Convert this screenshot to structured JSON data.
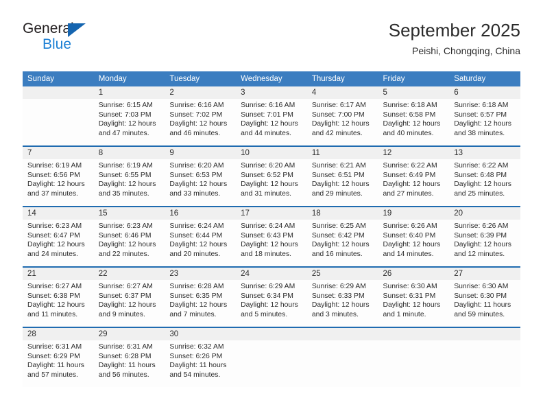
{
  "brand": {
    "name_part1": "General",
    "name_part2": "Blue",
    "triangle_icon": "brand-triangle-icon",
    "accent_blue": "#1b7fd4",
    "triangle_blue": "#1565b0"
  },
  "header": {
    "title": "September 2025",
    "subtitle": "Peishi, Chongqing, China"
  },
  "theme": {
    "header_bg": "#3b7dc0",
    "row_separator": "#1f6bb0",
    "daynum_bg": "#f0f0f0",
    "cell_bg": "#fdfdfd",
    "text": "#2b2b2b"
  },
  "calendar": {
    "columns": [
      "Sunday",
      "Monday",
      "Tuesday",
      "Wednesday",
      "Thursday",
      "Friday",
      "Saturday"
    ],
    "weeks": [
      [
        {
          "day": "",
          "lines": [
            "",
            "",
            "",
            ""
          ]
        },
        {
          "day": "1",
          "lines": [
            "Sunrise: 6:15 AM",
            "Sunset: 7:03 PM",
            "Daylight: 12 hours",
            "and 47 minutes."
          ]
        },
        {
          "day": "2",
          "lines": [
            "Sunrise: 6:16 AM",
            "Sunset: 7:02 PM",
            "Daylight: 12 hours",
            "and 46 minutes."
          ]
        },
        {
          "day": "3",
          "lines": [
            "Sunrise: 6:16 AM",
            "Sunset: 7:01 PM",
            "Daylight: 12 hours",
            "and 44 minutes."
          ]
        },
        {
          "day": "4",
          "lines": [
            "Sunrise: 6:17 AM",
            "Sunset: 7:00 PM",
            "Daylight: 12 hours",
            "and 42 minutes."
          ]
        },
        {
          "day": "5",
          "lines": [
            "Sunrise: 6:18 AM",
            "Sunset: 6:58 PM",
            "Daylight: 12 hours",
            "and 40 minutes."
          ]
        },
        {
          "day": "6",
          "lines": [
            "Sunrise: 6:18 AM",
            "Sunset: 6:57 PM",
            "Daylight: 12 hours",
            "and 38 minutes."
          ]
        }
      ],
      [
        {
          "day": "7",
          "lines": [
            "Sunrise: 6:19 AM",
            "Sunset: 6:56 PM",
            "Daylight: 12 hours",
            "and 37 minutes."
          ]
        },
        {
          "day": "8",
          "lines": [
            "Sunrise: 6:19 AM",
            "Sunset: 6:55 PM",
            "Daylight: 12 hours",
            "and 35 minutes."
          ]
        },
        {
          "day": "9",
          "lines": [
            "Sunrise: 6:20 AM",
            "Sunset: 6:53 PM",
            "Daylight: 12 hours",
            "and 33 minutes."
          ]
        },
        {
          "day": "10",
          "lines": [
            "Sunrise: 6:20 AM",
            "Sunset: 6:52 PM",
            "Daylight: 12 hours",
            "and 31 minutes."
          ]
        },
        {
          "day": "11",
          "lines": [
            "Sunrise: 6:21 AM",
            "Sunset: 6:51 PM",
            "Daylight: 12 hours",
            "and 29 minutes."
          ]
        },
        {
          "day": "12",
          "lines": [
            "Sunrise: 6:22 AM",
            "Sunset: 6:49 PM",
            "Daylight: 12 hours",
            "and 27 minutes."
          ]
        },
        {
          "day": "13",
          "lines": [
            "Sunrise: 6:22 AM",
            "Sunset: 6:48 PM",
            "Daylight: 12 hours",
            "and 25 minutes."
          ]
        }
      ],
      [
        {
          "day": "14",
          "lines": [
            "Sunrise: 6:23 AM",
            "Sunset: 6:47 PM",
            "Daylight: 12 hours",
            "and 24 minutes."
          ]
        },
        {
          "day": "15",
          "lines": [
            "Sunrise: 6:23 AM",
            "Sunset: 6:46 PM",
            "Daylight: 12 hours",
            "and 22 minutes."
          ]
        },
        {
          "day": "16",
          "lines": [
            "Sunrise: 6:24 AM",
            "Sunset: 6:44 PM",
            "Daylight: 12 hours",
            "and 20 minutes."
          ]
        },
        {
          "day": "17",
          "lines": [
            "Sunrise: 6:24 AM",
            "Sunset: 6:43 PM",
            "Daylight: 12 hours",
            "and 18 minutes."
          ]
        },
        {
          "day": "18",
          "lines": [
            "Sunrise: 6:25 AM",
            "Sunset: 6:42 PM",
            "Daylight: 12 hours",
            "and 16 minutes."
          ]
        },
        {
          "day": "19",
          "lines": [
            "Sunrise: 6:26 AM",
            "Sunset: 6:40 PM",
            "Daylight: 12 hours",
            "and 14 minutes."
          ]
        },
        {
          "day": "20",
          "lines": [
            "Sunrise: 6:26 AM",
            "Sunset: 6:39 PM",
            "Daylight: 12 hours",
            "and 12 minutes."
          ]
        }
      ],
      [
        {
          "day": "21",
          "lines": [
            "Sunrise: 6:27 AM",
            "Sunset: 6:38 PM",
            "Daylight: 12 hours",
            "and 11 minutes."
          ]
        },
        {
          "day": "22",
          "lines": [
            "Sunrise: 6:27 AM",
            "Sunset: 6:37 PM",
            "Daylight: 12 hours",
            "and 9 minutes."
          ]
        },
        {
          "day": "23",
          "lines": [
            "Sunrise: 6:28 AM",
            "Sunset: 6:35 PM",
            "Daylight: 12 hours",
            "and 7 minutes."
          ]
        },
        {
          "day": "24",
          "lines": [
            "Sunrise: 6:29 AM",
            "Sunset: 6:34 PM",
            "Daylight: 12 hours",
            "and 5 minutes."
          ]
        },
        {
          "day": "25",
          "lines": [
            "Sunrise: 6:29 AM",
            "Sunset: 6:33 PM",
            "Daylight: 12 hours",
            "and 3 minutes."
          ]
        },
        {
          "day": "26",
          "lines": [
            "Sunrise: 6:30 AM",
            "Sunset: 6:31 PM",
            "Daylight: 12 hours",
            "and 1 minute."
          ]
        },
        {
          "day": "27",
          "lines": [
            "Sunrise: 6:30 AM",
            "Sunset: 6:30 PM",
            "Daylight: 11 hours",
            "and 59 minutes."
          ]
        }
      ],
      [
        {
          "day": "28",
          "lines": [
            "Sunrise: 6:31 AM",
            "Sunset: 6:29 PM",
            "Daylight: 11 hours",
            "and 57 minutes."
          ]
        },
        {
          "day": "29",
          "lines": [
            "Sunrise: 6:31 AM",
            "Sunset: 6:28 PM",
            "Daylight: 11 hours",
            "and 56 minutes."
          ]
        },
        {
          "day": "30",
          "lines": [
            "Sunrise: 6:32 AM",
            "Sunset: 6:26 PM",
            "Daylight: 11 hours",
            "and 54 minutes."
          ]
        },
        {
          "day": "",
          "lines": [
            "",
            "",
            "",
            ""
          ]
        },
        {
          "day": "",
          "lines": [
            "",
            "",
            "",
            ""
          ]
        },
        {
          "day": "",
          "lines": [
            "",
            "",
            "",
            ""
          ]
        },
        {
          "day": "",
          "lines": [
            "",
            "",
            "",
            ""
          ]
        }
      ]
    ]
  }
}
